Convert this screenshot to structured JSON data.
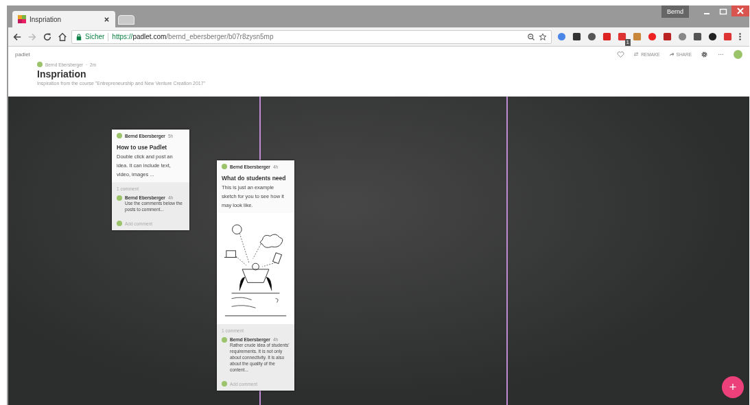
{
  "browser": {
    "tabs": [
      {
        "title": "Inspriation",
        "selected": true
      },
      {
        "selected": false
      }
    ],
    "profile": "Bernd",
    "address": {
      "secure_label": "Sicher",
      "url_scheme": "https://",
      "url_host": "padlet.com",
      "url_path": "/bernd_ebersberger/b07r8zysn5mp"
    },
    "extension_badge": "1"
  },
  "padlet": {
    "logo": "padlet",
    "author": "Bernd Ebersberger",
    "separator": "·",
    "age": "2m",
    "title": "Inspriation",
    "description": "Inspiration from the course \"Entrepreneurship and New Venture Creation 2017\"",
    "actions": [
      {
        "kind": "like"
      },
      {
        "kind": "remake",
        "label": "REMAKE"
      },
      {
        "kind": "share",
        "label": "SHARE"
      },
      {
        "kind": "settings"
      },
      {
        "kind": "more"
      },
      {
        "kind": "avatar"
      }
    ]
  },
  "posts": [
    {
      "author": "Bernd Ebersberger",
      "age": "5h",
      "title": "How to use Padlet",
      "body": "Double click and post an idea. It can include text, video, images ...",
      "has_image": false,
      "comment_count": "1 comment",
      "comments": [
        {
          "author": "Bernd Ebersberger",
          "age": "4h",
          "text": "Use the comments below the posts to comment..."
        }
      ],
      "add_comment": "Add comment"
    },
    {
      "author": "Bernd Ebersberger",
      "age": "4h",
      "title": "What do students need",
      "body": "This is just an example sketch for you to see how it may look like.",
      "has_image": true,
      "comment_count": "1 comment",
      "comments": [
        {
          "author": "Bernd Ebersberger",
          "age": "4h",
          "text": "Rather crude idea of students' requirements. It is not only about connectivity. It is also about the quality of the content..."
        }
      ],
      "add_comment": "Add comment"
    }
  ],
  "fab": "+"
}
